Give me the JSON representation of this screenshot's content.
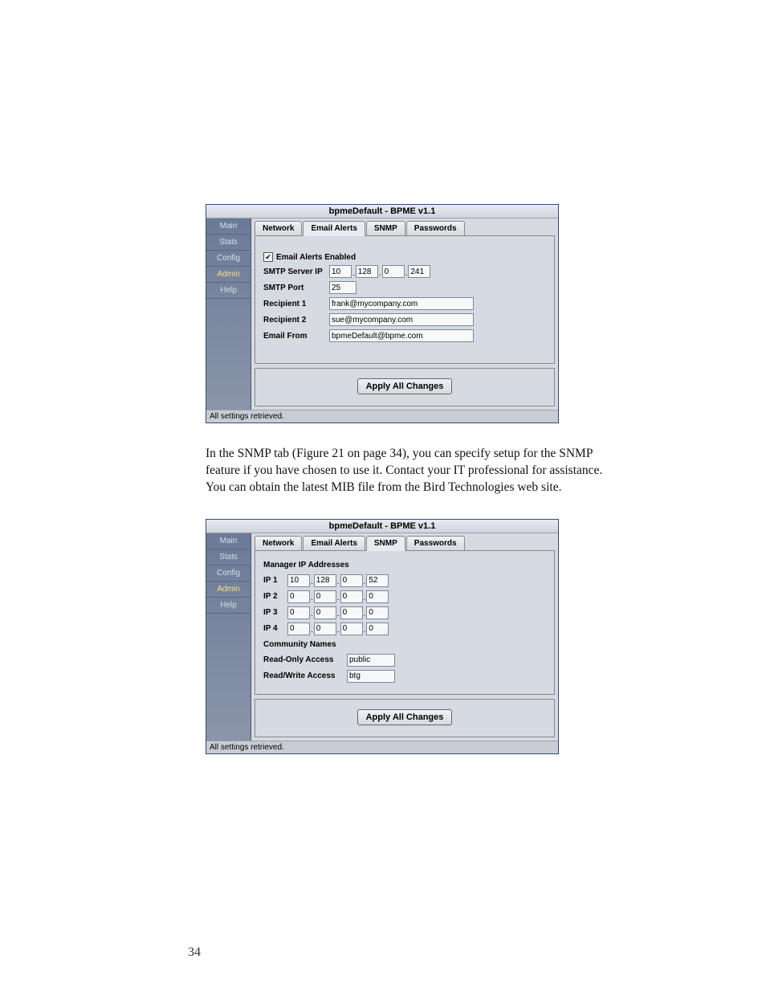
{
  "pageNumber": "34",
  "bodyText": "In the SNMP tab (Figure 21 on page 34), you can specify setup for the SNMP feature if you have chosen to use it. Contact your IT professional for assistance. You can obtain the latest MIB file from the Bird Technologies web site.",
  "app1": {
    "title": "bpmeDefault - BPME v1.1",
    "sidebar": [
      "Main",
      "Stats",
      "Config",
      "Admin",
      "Help"
    ],
    "sidebarActive": 3,
    "tabs": [
      "Network",
      "Email Alerts",
      "SNMP",
      "Passwords"
    ],
    "activeTab": 1,
    "emailAlerts": {
      "checkboxLabel": "Email Alerts Enabled",
      "checked": true,
      "smtpServerLabel": "SMTP Server IP",
      "smtpServerIP": [
        "10",
        "128",
        "0",
        "241"
      ],
      "smtpPortLabel": "SMTP Port",
      "smtpPort": "25",
      "recipient1Label": "Recipient 1",
      "recipient1": "frank@mycompany.com",
      "recipient2Label": "Recipient 2",
      "recipient2": "sue@mycompany.com",
      "emailFromLabel": "Email From",
      "emailFrom": "bpmeDefault@bpme.com"
    },
    "applyLabel": "Apply All Changes",
    "status": "All settings retrieved."
  },
  "app2": {
    "title": "bpmeDefault - BPME v1.1",
    "sidebar": [
      "Main",
      "Stats",
      "Config",
      "Admin",
      "Help"
    ],
    "sidebarActive": 3,
    "tabs": [
      "Network",
      "Email Alerts",
      "SNMP",
      "Passwords"
    ],
    "activeTab": 2,
    "snmp": {
      "managerHeading": "Manager IP Addresses",
      "ips": [
        {
          "label": "IP 1",
          "oct": [
            "10",
            "128",
            "0",
            "52"
          ]
        },
        {
          "label": "IP 2",
          "oct": [
            "0",
            "0",
            "0",
            "0"
          ]
        },
        {
          "label": "IP 3",
          "oct": [
            "0",
            "0",
            "0",
            "0"
          ]
        },
        {
          "label": "IP 4",
          "oct": [
            "0",
            "0",
            "0",
            "0"
          ]
        }
      ],
      "communityHeading": "Community Names",
      "readOnlyLabel": "Read-Only Access",
      "readOnly": "public",
      "readWriteLabel": "Read/Write Access",
      "readWrite": "btg"
    },
    "applyLabel": "Apply All Changes",
    "status": "All settings retrieved."
  }
}
